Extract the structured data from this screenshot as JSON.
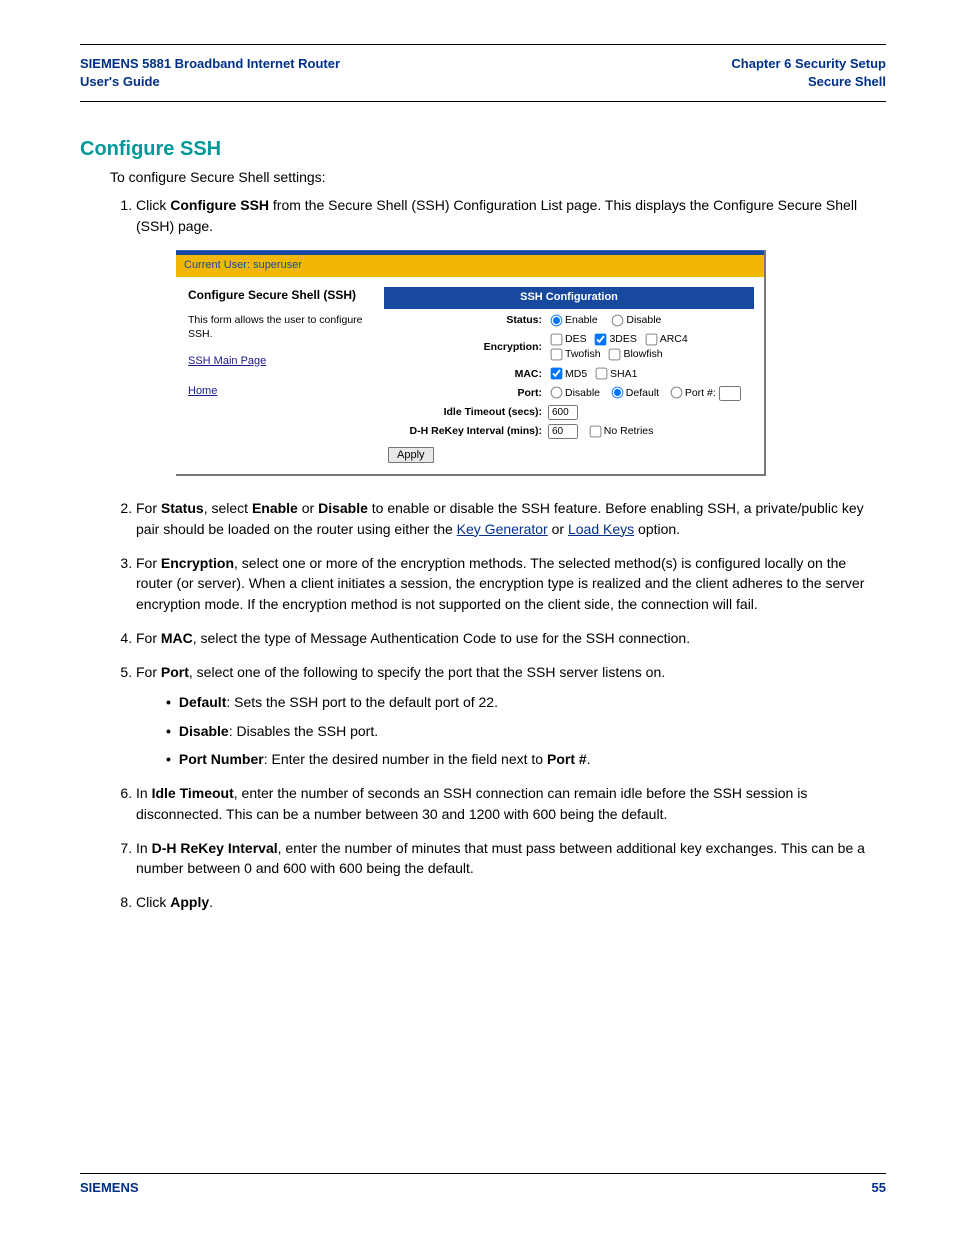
{
  "header": {
    "left_line1": "SIEMENS 5881 Broadband Internet Router",
    "left_line2": "User's Guide",
    "right_line1": "Chapter 6  Security Setup",
    "right_line2": "Secure Shell"
  },
  "heading": "Configure SSH",
  "intro": "To configure Secure Shell settings:",
  "ui": {
    "current_user_label": "Current User: superuser",
    "pane_title": "Configure Secure Shell (SSH)",
    "pane_desc": "This form allows the user to configure SSH.",
    "link_main": "SSH Main Page",
    "link_home": "Home",
    "config_title": "SSH Configuration",
    "rows": {
      "status_label": "Status:",
      "status_enable": "Enable",
      "status_disable": "Disable",
      "enc_label": "Encryption:",
      "enc_des": "DES",
      "enc_3des": "3DES",
      "enc_arc4": "ARC4",
      "enc_twofish": "Twofish",
      "enc_blowfish": "Blowfish",
      "mac_label": "MAC:",
      "mac_md5": "MD5",
      "mac_sha1": "SHA1",
      "port_label": "Port:",
      "port_disable": "Disable",
      "port_default": "Default",
      "port_num": "Port #:",
      "idle_label": "Idle Timeout (secs):",
      "idle_value": "600",
      "dh_label": "D-H ReKey Interval (mins):",
      "dh_value": "60",
      "noretries": "No Retries",
      "apply": "Apply"
    }
  },
  "steps": {
    "s1a": "Click ",
    "s1b": "Configure SSH",
    "s1c": " from the Secure Shell (SSH) Configuration List page. This displays the Configure Secure Shell (SSH) page.",
    "s2a": "For ",
    "s2b": "Status",
    "s2c": ", select ",
    "s2d": "Enable",
    "s2e": " or ",
    "s2f": "Disable",
    "s2g": " to enable or disable the SSH feature. Before enabling SSH, a private/public key pair should be loaded on the router using either the ",
    "s2_link1": "Key Generator",
    "s2_or": " or ",
    "s2_link2": "Load Keys",
    "s2h": " option.",
    "s3a": "For ",
    "s3b": "Encryption",
    "s3c": ", select one or more of the encryption methods. The selected method(s) is configured locally on the router (or server). When a client initiates a session, the encryption type is realized and the client adheres to the server encryption mode. If the encryption method is not supported on the client side, the connection will fail.",
    "s4a": "For ",
    "s4b": "MAC",
    "s4c": ", select the type of Message Authentication Code to use for the SSH connection.",
    "s5a": "For ",
    "s5b": "Port",
    "s5c": ", select one of the following to specify the port that the SSH server listens on.",
    "b1a": "Default",
    "b1b": ": Sets the SSH port to the default port of 22.",
    "b2a": "Disable",
    "b2b": ": Disables the SSH port.",
    "b3a": "Port Number",
    "b3b": ": Enter the desired number in the field next to ",
    "b3c": "Port #",
    "b3d": ".",
    "s6a": "In ",
    "s6b": "Idle Timeout",
    "s6c": ", enter the number of seconds an SSH connection can remain idle before the SSH session is disconnected. This can be a number between 30 and 1200 with 600 being the default.",
    "s7a": "In ",
    "s7b": "D-H ReKey Interval",
    "s7c": ", enter the number of minutes that must pass between additional key exchanges. This can be a number between 0 and 600 with 600 being the default.",
    "s8a": "Click ",
    "s8b": "Apply",
    "s8c": "."
  },
  "footer": {
    "brand": "SIEMENS",
    "page": "55"
  }
}
